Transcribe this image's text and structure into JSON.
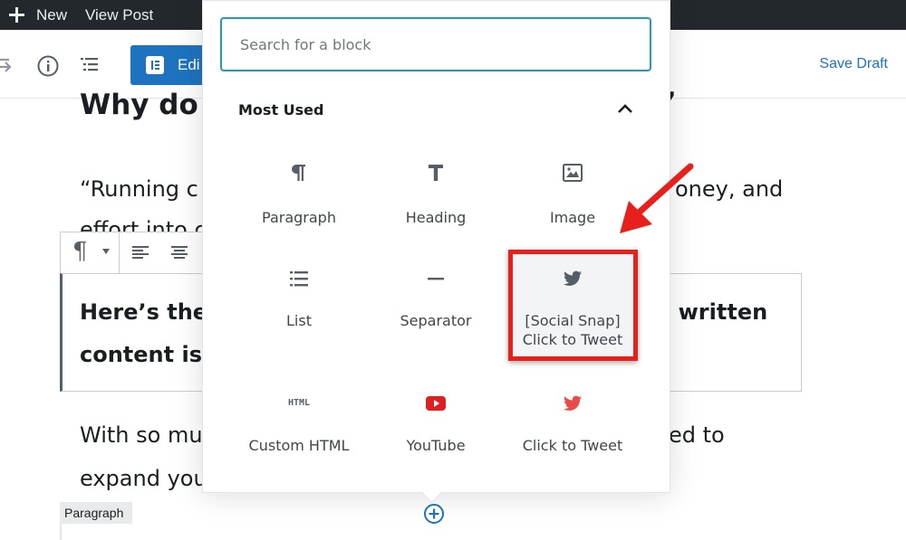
{
  "admin_bar": {
    "new_label": "New",
    "view_post_label": "View Post"
  },
  "toolbar": {
    "edit_label": "Edi",
    "save_draft_label": "Save Draft"
  },
  "post": {
    "heading_partial": "Why do",
    "heading_tail": "’",
    "para1_left": "“Running c",
    "para1_right": "oney, and",
    "para1_line2": "effort into c",
    "bold_line1_left": "Here’s the",
    "bold_line1_right": "e written",
    "bold_line2_left": "content is r",
    "para3_left": "With so mu",
    "para3_right": "ed to",
    "para3_line2": "expand you",
    "block_label": "Paragraph"
  },
  "inserter": {
    "search_placeholder": "Search for a block",
    "search_value": "",
    "section_title": "Most Used",
    "blocks": [
      {
        "label": "Paragraph",
        "icon": "paragraph-icon"
      },
      {
        "label": "Heading",
        "icon": "heading-icon"
      },
      {
        "label": "Image",
        "icon": "image-icon"
      },
      {
        "label": "List",
        "icon": "list-icon"
      },
      {
        "label": "Separator",
        "icon": "separator-icon"
      },
      {
        "label": "[Social Snap]",
        "label2": "Click to Tweet",
        "icon": "twitter-icon"
      },
      {
        "label": "Custom HTML",
        "icon": "html-icon",
        "icon_text": "HTML"
      },
      {
        "label": "YouTube",
        "icon": "youtube-icon"
      },
      {
        "label": "Click to Tweet",
        "icon": "twitter-icon"
      }
    ]
  },
  "colors": {
    "admin_bar_bg": "#23282d",
    "primary_blue": "#1e73be",
    "focus_blue": "#1f9ac2",
    "annotation_red": "#e8201b",
    "youtube_red": "#e02020",
    "tweet_red": "#e94b4b"
  }
}
